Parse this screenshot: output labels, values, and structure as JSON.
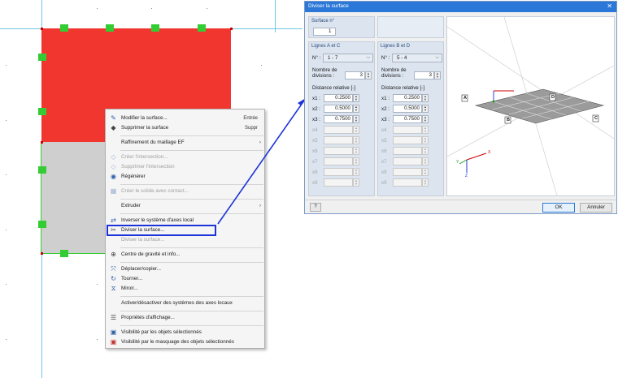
{
  "context_menu": {
    "items": [
      {
        "label": "Modifier la surface...",
        "shortcut": "Entrée",
        "icon": "edit-surface-icon",
        "disabled": false
      },
      {
        "label": "Supprimer la surface",
        "shortcut": "Suppr",
        "icon": "delete-surface-icon",
        "disabled": false
      },
      {
        "label": "Raffinement du maillage EF",
        "submenu": true,
        "disabled": false
      },
      {
        "label": "Créer l'intersection...",
        "icon": "create-intersection-icon",
        "disabled": true
      },
      {
        "label": "Supprimer l'intersection",
        "icon": "delete-intersection-icon",
        "disabled": true
      },
      {
        "label": "Régénérer",
        "icon": "regenerate-icon",
        "disabled": false
      },
      {
        "label": "Créer le solide avec contact...",
        "icon": "solid-contact-icon",
        "disabled": true
      },
      {
        "label": "Extruder",
        "submenu": true,
        "disabled": false
      },
      {
        "label": "Inverser le système d'axes local",
        "icon": "invert-axes-icon",
        "disabled": false
      },
      {
        "label": "Diviser la surface...",
        "icon": "divide-surface-icon",
        "disabled": false,
        "highlighted": true
      },
      {
        "label": "Diviser la surface...",
        "disabled": true
      },
      {
        "label": "Centre de gravité et info...",
        "icon": "center-gravity-icon",
        "disabled": false
      },
      {
        "label": "Déplacer/copier...",
        "icon": "move-copy-icon",
        "disabled": false
      },
      {
        "label": "Tourner...",
        "icon": "rotate-icon",
        "disabled": false
      },
      {
        "label": "Miroir...",
        "icon": "mirror-icon",
        "disabled": false
      },
      {
        "label": "Activer/désactiver des systèmes des axes locaux",
        "disabled": false
      },
      {
        "label": "Propriétés d'affichage...",
        "icon": "display-properties-icon",
        "disabled": false
      },
      {
        "label": "Visibilité par les objets sélectionnés",
        "icon": "visibility-selected-icon",
        "disabled": false
      },
      {
        "label": "Visibilité par le masquage des objets sélectionnés",
        "icon": "visibility-hide-icon",
        "disabled": false
      }
    ]
  },
  "dialog": {
    "title": "Diviser la surface",
    "close_glyph": "✕",
    "surface": {
      "label": "Surface n°",
      "value": "1"
    },
    "lines_ac": {
      "header": "Lignes A et C",
      "no_label": "N° :",
      "selected": "1 - 7",
      "divisions_label_1": "Nombre de",
      "divisions_label_2": "divisions :",
      "divisions_value": "3",
      "distance_label": "Distance relative [-]",
      "rows": [
        {
          "label": "x1 :",
          "value": "0.2500",
          "enabled": true
        },
        {
          "label": "x2 :",
          "value": "0.5000",
          "enabled": true
        },
        {
          "label": "x3 :",
          "value": "0.7500",
          "enabled": true
        },
        {
          "label": "x4",
          "value": "",
          "enabled": false
        },
        {
          "label": "x5",
          "value": "",
          "enabled": false
        },
        {
          "label": "x6",
          "value": "",
          "enabled": false
        },
        {
          "label": "x7",
          "value": "",
          "enabled": false
        },
        {
          "label": "x8",
          "value": "",
          "enabled": false
        },
        {
          "label": "x9",
          "value": "",
          "enabled": false
        }
      ]
    },
    "lines_bd": {
      "header": "Lignes B et D",
      "no_label": "N° :",
      "selected": "5 - 4",
      "divisions_label_1": "Nombre de",
      "divisions_label_2": "divisions :",
      "divisions_value": "3",
      "distance_label": "Distance relative [-]",
      "rows": [
        {
          "label": "x1 :",
          "value": "0.2500",
          "enabled": true
        },
        {
          "label": "x2 :",
          "value": "0.5000",
          "enabled": true
        },
        {
          "label": "x3 :",
          "value": "0.7500",
          "enabled": true
        },
        {
          "label": "x4",
          "value": "",
          "enabled": false
        },
        {
          "label": "x5",
          "value": "",
          "enabled": false
        },
        {
          "label": "x6",
          "value": "",
          "enabled": false
        },
        {
          "label": "x7",
          "value": "",
          "enabled": false
        },
        {
          "label": "x8",
          "value": "",
          "enabled": false
        },
        {
          "label": "x9",
          "value": "",
          "enabled": false
        }
      ]
    },
    "preview": {
      "edge_labels": [
        "A",
        "B",
        "C",
        "D"
      ],
      "axis_x": "X",
      "axis_y": "Y",
      "axis_z": "Z"
    },
    "buttons": {
      "ok": "OK",
      "cancel": "Annuler",
      "help_glyph": "?"
    }
  },
  "colors": {
    "surface_red": "#f0362f",
    "surface_grey": "#cfcfcf",
    "node_green": "#33cc33",
    "highlight_blue": "#1c33d9",
    "title_bar": "#2b78d8"
  }
}
